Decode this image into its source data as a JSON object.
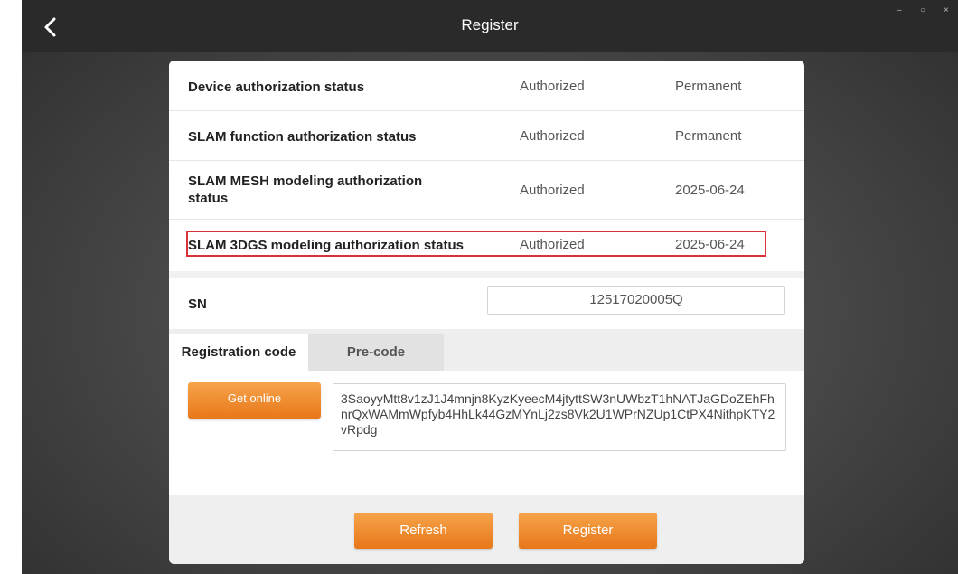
{
  "window": {
    "title": "Register",
    "controls": {
      "minimize": "–",
      "restore": "○",
      "close": "×"
    }
  },
  "status_rows": [
    {
      "label": "Device authorization status",
      "state": "Authorized",
      "expiry": "Permanent"
    },
    {
      "label": "SLAM function authorization status",
      "state": "Authorized",
      "expiry": "Permanent"
    },
    {
      "label": "SLAM MESH modeling authorization status",
      "state": "Authorized",
      "expiry": "2025-06-24"
    },
    {
      "label": "SLAM 3DGS modeling authorization status",
      "state": "Authorized",
      "expiry": "2025-06-24",
      "highlighted": true
    }
  ],
  "sn": {
    "label": "SN",
    "value": "12517020005Q"
  },
  "tabs": [
    {
      "label": "Registration code",
      "active": true
    },
    {
      "label": "Pre-code",
      "active": false
    }
  ],
  "registration": {
    "get_online_label": "Get online",
    "code": "3SaoyyMtt8v1zJ1J4mnjn8KyzKyeecM4jtyttSW3nUWbzT1hNATJaGDoZEhFhnrQxWAMmWpfyb4HhLk44GzMYnLj2zs8Vk2U1WPrNZUp1CtPX4NithpKTY2vRpdg"
  },
  "footer": {
    "refresh_label": "Refresh",
    "register_label": "Register"
  },
  "colors": {
    "accent": "#f0892a",
    "highlight_border": "#d9323a",
    "titlebar": "#2a2a2a"
  },
  "icons": {
    "back": "chevron-left-icon"
  }
}
